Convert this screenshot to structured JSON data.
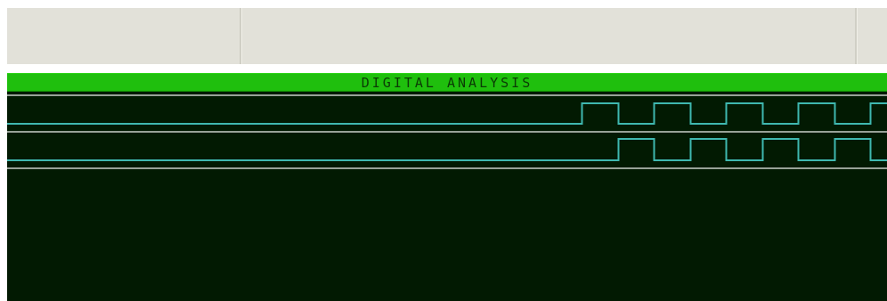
{
  "analysis": {
    "title": "DIGITAL ANALYSIS",
    "colors": {
      "toolbar_bg": "#e2e1d9",
      "title_bar": "#1fbf0d",
      "title_text": "#0b3b05",
      "plot_bg": "#021a02",
      "trace": "#3fb8b0",
      "separator": "#c9d0c9"
    },
    "traces": [
      {
        "edges": [
          0.653,
          0.694,
          0.735,
          0.776,
          0.817,
          0.858,
          0.899,
          0.94,
          0.981
        ]
      },
      {
        "edges": [
          0.694,
          0.735,
          0.776,
          0.817,
          0.858,
          0.899,
          0.94,
          0.981
        ]
      }
    ]
  }
}
